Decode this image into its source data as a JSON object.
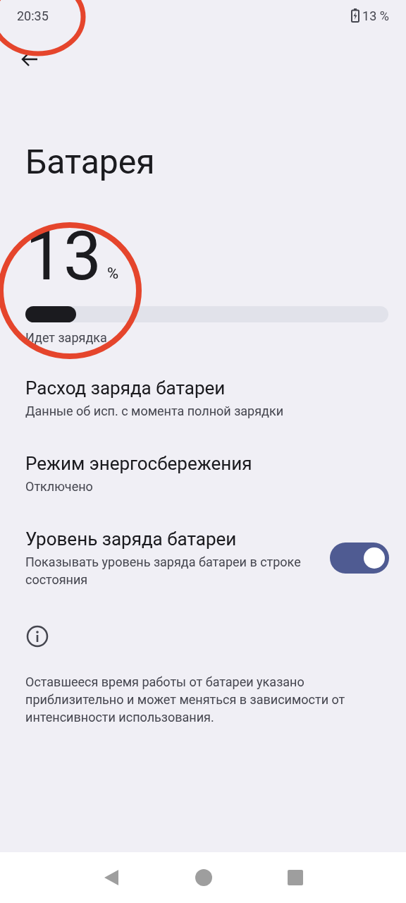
{
  "status_bar": {
    "time": "20:35",
    "battery": "13 %"
  },
  "title": "Батарея",
  "battery": {
    "percent": "13",
    "unit": "%",
    "level": 0.14,
    "status": "Идет зарядка"
  },
  "items": [
    {
      "kind": "link",
      "title": "Расход заряда батареи",
      "subtitle": "Данные об исп. с момента полной зарядки"
    },
    {
      "kind": "link",
      "title": "Режим энергосбережения",
      "subtitle": "Отключено"
    },
    {
      "kind": "switch",
      "title": "Уровень заряда батареи",
      "subtitle": "Показывать уровень заряда батареи в строке состояния",
      "on": true
    }
  ],
  "footer": "Оставшееся время работы от батареи указано приблизительно и может меняться в зависимости от интенсивности использования."
}
